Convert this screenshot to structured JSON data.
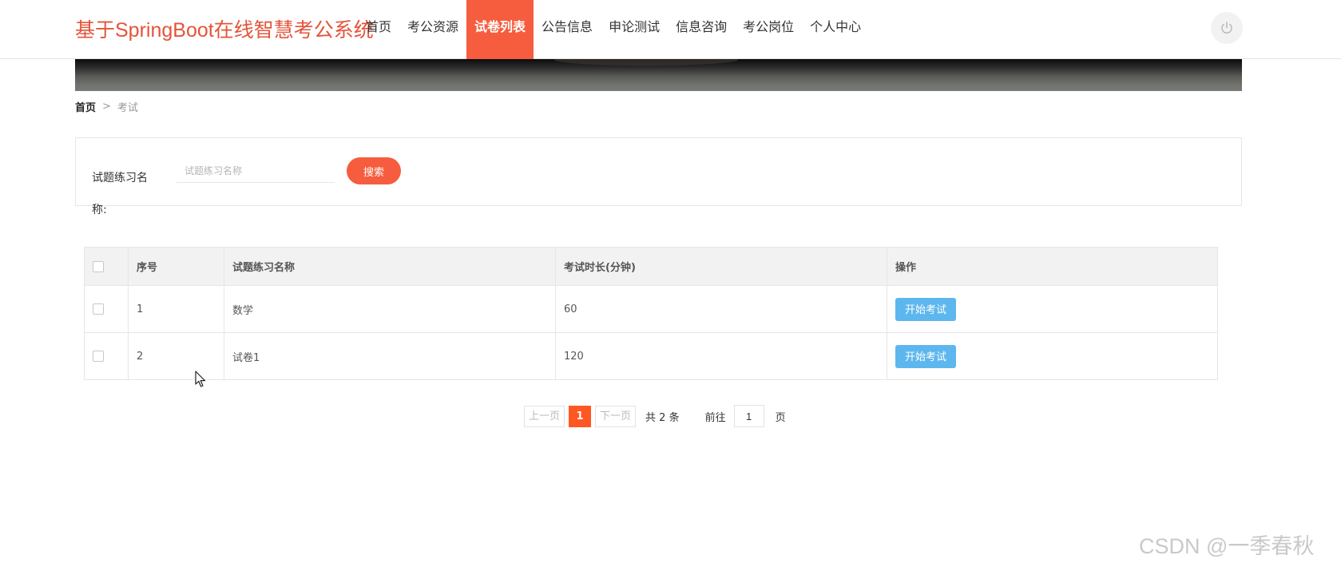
{
  "header": {
    "logo": "基于SpringBoot在线智慧考公系统",
    "nav": [
      "首页",
      "考公资源",
      "试卷列表",
      "公告信息",
      "申论测试",
      "信息咨询",
      "考公岗位",
      "个人中心"
    ],
    "active_nav": "试卷列表",
    "power_icon": "power-icon"
  },
  "breadcrumb": {
    "home": "首页",
    "separator": ">",
    "current": "考试"
  },
  "search": {
    "label": "试题练习名称:",
    "placeholder": "试题练习名称",
    "value": "",
    "button": "搜索"
  },
  "table": {
    "columns": [
      "序号",
      "试题练习名称",
      "考试时长(分钟)",
      "操作"
    ],
    "rows": [
      {
        "no": "1",
        "name": "数学",
        "duration": "60",
        "action": "开始考试"
      },
      {
        "no": "2",
        "name": "试卷1",
        "duration": "120",
        "action": "开始考试"
      }
    ]
  },
  "pagination": {
    "prev": "上一页",
    "current": "1",
    "next": "下一页",
    "total": "共 2 条",
    "goto": "前往",
    "goto_value": "1",
    "unit": "页"
  },
  "watermark": "CSDN @一季春秋",
  "colors": {
    "brand": "#f55d3e",
    "action_button": "#5db7ee",
    "page_active": "#ff5722"
  }
}
